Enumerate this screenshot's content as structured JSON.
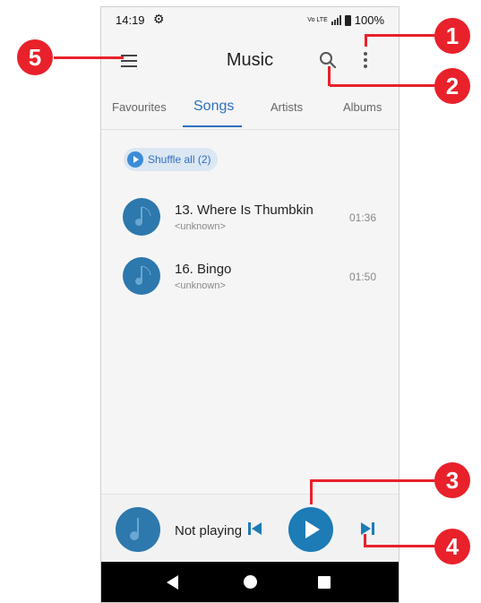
{
  "status_bar": {
    "time": "14:19",
    "network": "Vo LTE",
    "battery": "100%"
  },
  "app_bar": {
    "title": "Music"
  },
  "tabs": [
    {
      "label": "Favourites",
      "active": false
    },
    {
      "label": "Songs",
      "active": true
    },
    {
      "label": "Artists",
      "active": false
    },
    {
      "label": "Albums",
      "active": false
    }
  ],
  "shuffle": {
    "label": "Shuffle all (2)"
  },
  "songs": [
    {
      "title": "13. Where Is Thumbkin",
      "artist": "<unknown>",
      "duration": "01:36"
    },
    {
      "title": "16. Bingo",
      "artist": "<unknown>",
      "duration": "01:50"
    }
  ],
  "player": {
    "status": "Not playing"
  },
  "callouts": [
    "1",
    "2",
    "3",
    "4",
    "5"
  ],
  "colors": {
    "accent": "#2f6fbf",
    "callout": "#e8212b",
    "art": "#2d78ad",
    "play": "#1d7bb6"
  },
  "icons": {
    "menu": "hamburger-icon",
    "search": "search-icon",
    "more": "more-vert-icon",
    "shuffle": "play-circle-icon",
    "previous": "skip-previous-icon",
    "play": "play-icon",
    "next": "skip-next-icon",
    "back": "back-icon",
    "home": "home-icon",
    "recents": "recents-icon"
  }
}
